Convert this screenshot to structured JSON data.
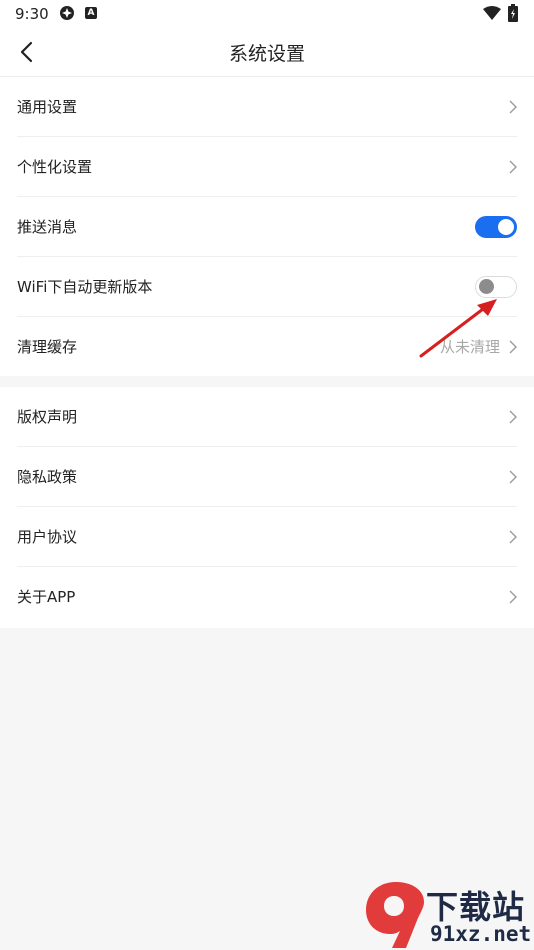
{
  "status_bar": {
    "time": "9:30",
    "icons": [
      "app-icon",
      "a-icon",
      "wifi-icon",
      "battery-icon"
    ]
  },
  "header": {
    "title": "系统设置",
    "back_icon": "back-arrow-icon"
  },
  "group1": [
    {
      "label": "通用设置",
      "type": "link"
    },
    {
      "label": "个性化设置",
      "type": "link"
    },
    {
      "label": "推送消息",
      "type": "toggle",
      "enabled": true
    },
    {
      "label": "WiFi下自动更新版本",
      "type": "toggle",
      "enabled": false
    },
    {
      "label": "清理缓存",
      "type": "link",
      "value": "从未清理"
    }
  ],
  "group2": [
    {
      "label": "版权声明",
      "type": "link"
    },
    {
      "label": "隐私政策",
      "type": "link"
    },
    {
      "label": "用户协议",
      "type": "link"
    },
    {
      "label": "关于APP",
      "type": "link"
    }
  ],
  "watermark": {
    "logo_text": "9",
    "title": "下载站",
    "url": "91xz.net"
  },
  "colors": {
    "accent": "#1a6ef0",
    "annotation_arrow": "#d61f1f",
    "watermark_red": "#e23b3b"
  }
}
